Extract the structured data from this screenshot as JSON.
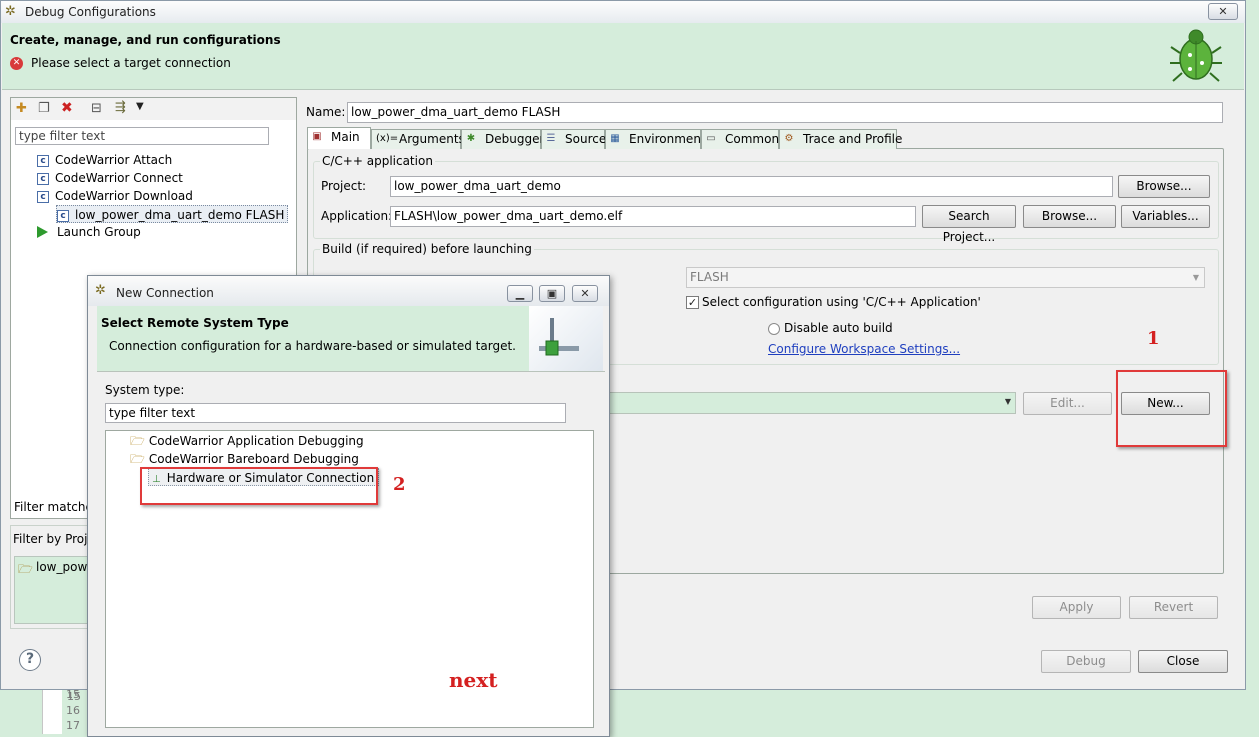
{
  "debug_window": {
    "title": "Debug Configurations",
    "close_glyph": "✕",
    "header_title": "Create, manage, and run configurations",
    "header_message": "Please select a target connection",
    "header_icon": "bug-icon",
    "filter_placeholder": "type filter text",
    "tree": [
      {
        "label": "CodeWarrior Attach",
        "icon": "launch-config-icon"
      },
      {
        "label": "CodeWarrior Connect",
        "icon": "launch-config-icon"
      },
      {
        "label": "CodeWarrior Download",
        "icon": "launch-config-icon"
      },
      {
        "label": "low_power_dma_uart_demo FLASH",
        "icon": "launch-config-icon"
      },
      {
        "label": "Launch Group",
        "icon": "launch-group-icon"
      }
    ],
    "filter_matched": "Filter matched",
    "filter_by_project": "Filter by Proje",
    "project_item": "low_powe",
    "name_label": "Name:",
    "name_value": "low_power_dma_uart_demo FLASH",
    "tabs": [
      "Main",
      "Arguments",
      "Debugger",
      "Source",
      "Environment",
      "Common",
      "Trace and Profile"
    ],
    "cpp_group": "C/C++ application",
    "project_label": "Project:",
    "project_value": "low_power_dma_uart_demo",
    "browse_label": "Browse...",
    "application_label": "Application:",
    "application_value": "FLASH\\low_power_dma_uart_demo.elf",
    "search_project_label": "Search Project...",
    "variables_label": "Variables...",
    "build_group": "Build (if required) before launching",
    "build_config_value": "FLASH",
    "select_config_label": "Select configuration using 'C/C++ Application'",
    "disable_auto_build": "Disable auto build",
    "configure_workspace_link": "Configure Workspace Settings...",
    "edit_label": "Edit...",
    "new_label": "New...",
    "apply_label": "Apply",
    "revert_label": "Revert",
    "debug_label": "Debug",
    "close_label": "Close",
    "help_glyph": "?"
  },
  "editor_lines": [
    "15",
    "16",
    "17"
  ],
  "new_connection": {
    "title": "New Connection",
    "heading": "Select Remote System Type",
    "description": "Connection configuration for a hardware-based or simulated target.",
    "system_type_label": "System type:",
    "filter_placeholder": "type filter text",
    "tree": [
      {
        "label": "CodeWarrior Application Debugging",
        "icon": "folder-icon"
      },
      {
        "label": "CodeWarrior Bareboard Debugging",
        "icon": "folder-icon"
      },
      {
        "label": "Hardware or Simulator Connection",
        "icon": "connection-icon"
      }
    ]
  },
  "annotations": {
    "step1": "1",
    "step2": "2",
    "next": "next",
    "color": "#d42020"
  }
}
